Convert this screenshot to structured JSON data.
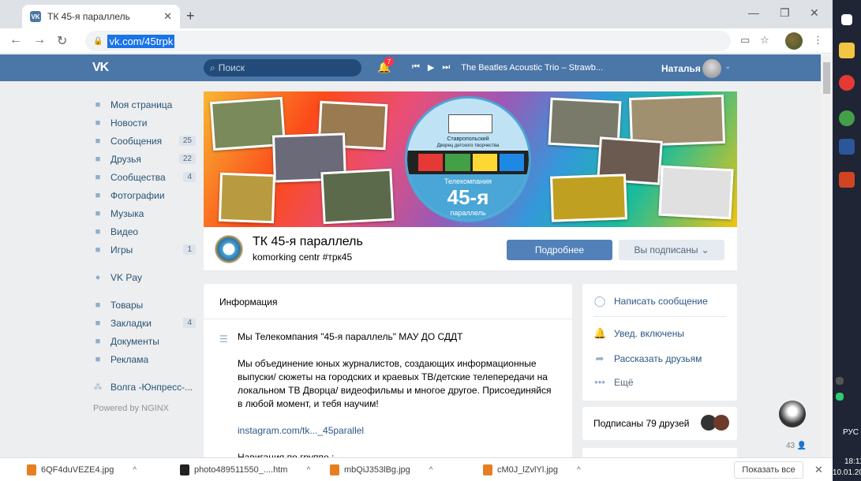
{
  "browser": {
    "tab_title": "ТК 45-я параллель",
    "url": "vk.com/45trpk"
  },
  "vk_header": {
    "search_placeholder": "Поиск",
    "notifications_count": "7",
    "now_playing": "The Beatles Acoustic Trio – Strawb...",
    "user_name": "Наталья"
  },
  "left_menu": {
    "items": [
      {
        "label": "Моя страница",
        "icon": "home-icon",
        "count": ""
      },
      {
        "label": "Новости",
        "icon": "news-icon",
        "count": ""
      },
      {
        "label": "Сообщения",
        "icon": "messages-icon",
        "count": "25"
      },
      {
        "label": "Друзья",
        "icon": "friends-icon",
        "count": "22"
      },
      {
        "label": "Сообщества",
        "icon": "groups-icon",
        "count": "4"
      },
      {
        "label": "Фотографии",
        "icon": "photos-icon",
        "count": ""
      },
      {
        "label": "Музыка",
        "icon": "music-icon",
        "count": ""
      },
      {
        "label": "Видео",
        "icon": "video-icon",
        "count": ""
      },
      {
        "label": "Игры",
        "icon": "games-icon",
        "count": "1"
      }
    ],
    "vkpay": "VK Pay",
    "items2": [
      {
        "label": "Товары",
        "icon": "goods-icon",
        "count": ""
      },
      {
        "label": "Закладки",
        "icon": "bookmarks-icon",
        "count": "4"
      },
      {
        "label": "Документы",
        "icon": "documents-icon",
        "count": ""
      },
      {
        "label": "Реклама",
        "icon": "ads-icon",
        "count": ""
      }
    ],
    "group_link": "Волга -Юнпресс-...",
    "powered": "Powered by NGINX"
  },
  "cover": {
    "line1": "Ставропольский",
    "line2": "Дворец детского творчества",
    "line3": "Телекомпания",
    "line4": "45-я",
    "line5": "параллель"
  },
  "group": {
    "name": "ТК 45-я параллель",
    "status": "komorking centr #трк45",
    "more_button": "Подробнее",
    "subscribed_button": "Вы подписаны"
  },
  "info": {
    "header": "Информация",
    "p1": "Мы Телекомпания \"45-я параллель\" МАУ ДО СДДТ",
    "p2": "Мы объединение юных журналистов, создающих информационные выпуски/ сюжеты на городских и краевых ТВ/детские телепередачи на локальном ТВ Дворца/ видеофильмы и многое другое. Присоединяйся в любой момент, и тебя научим!",
    "link": "instagram.com/tk..._45parallel",
    "nav": "Навигация по группе :"
  },
  "actions": {
    "write": "Написать сообщение",
    "notif": "Увед. включены",
    "share": "Рассказать друзьям",
    "more": "Ещё"
  },
  "friends": {
    "label": "Подписаны 79 друзей"
  },
  "chat": {
    "count": "43"
  },
  "downloads": {
    "files": [
      "6QF4duVEZE4.jpg",
      "photo489511550_....htm",
      "mbQiJ353lBg.jpg",
      "cM0J_lZvlYl.jpg"
    ],
    "show_all": "Показать все"
  },
  "tray": {
    "lang": "РУС",
    "time": "18:11",
    "date": "10.01.20"
  },
  "colors": {
    "vk_blue": "#4a76a8",
    "vk_button": "#5181b8",
    "page_bg": "#edeef0",
    "link": "#2a5885"
  }
}
